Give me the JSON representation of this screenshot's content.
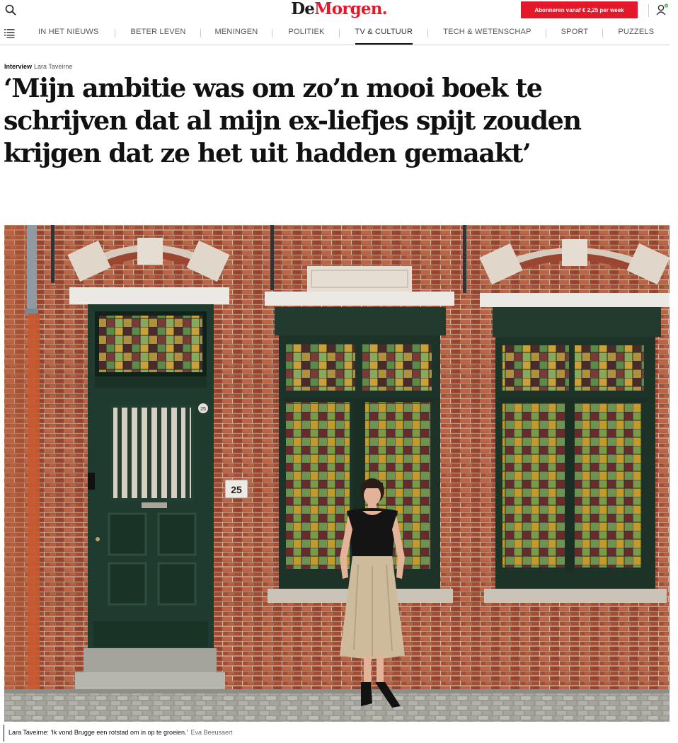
{
  "header": {
    "logo": {
      "part1": "De",
      "part2": "Morgen",
      "part3": "."
    },
    "subscribe_label": "Abonneren vanaf € 2,25 per week",
    "search_icon": "search-icon",
    "account_icon": "user-icon",
    "accent_color": "#e3192b"
  },
  "nav": {
    "menu_icon": "menu-list-icon",
    "items": [
      {
        "label": "IN HET NIEUWS"
      },
      {
        "label": "BETER LEVEN"
      },
      {
        "label": "MENINGEN"
      },
      {
        "label": "POLITIEK"
      },
      {
        "label": "TV & CULTUUR",
        "active": true
      },
      {
        "label": "TECH & WETENSCHAP"
      },
      {
        "label": "SPORT"
      },
      {
        "label": "PUZZELS"
      }
    ]
  },
  "article": {
    "type": "Interview",
    "author": "Lara Taveirne",
    "headline": "‘Mijn ambitie was om zo’n mooi boek te schrijven dat al mijn ex-liefjes spijt zouden krijgen dat ze het uit hadden gemaakt’",
    "photo": {
      "house_number": "25",
      "door_number": "25",
      "caption": "Lara Taveirne: ‘Ik vond Brugge een rotstad om in op te groeien.’",
      "credit": "Eva Beeusaert"
    }
  }
}
